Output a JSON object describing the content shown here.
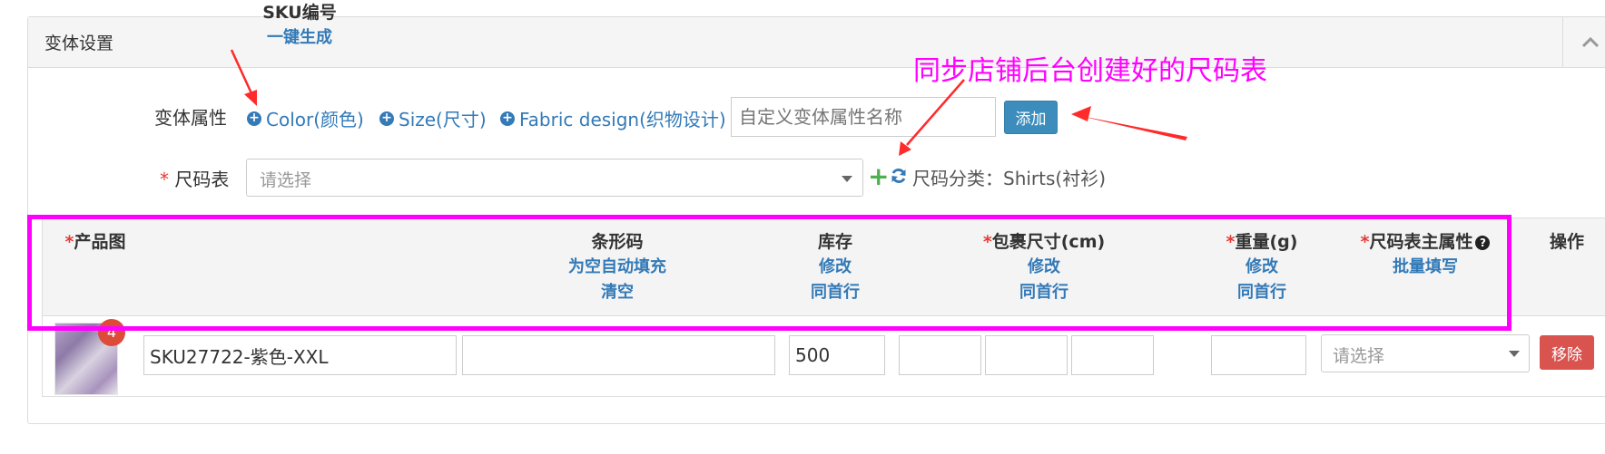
{
  "panel": {
    "title": "变体设置"
  },
  "variant_attrs": {
    "label": "变体属性",
    "options": [
      "Color(颜色)",
      "Size(尺寸)",
      "Fabric design(织物设计)"
    ],
    "custom_placeholder": "自定义变体属性名称",
    "add_label": "添加"
  },
  "size_chart": {
    "required_mark": "*",
    "label": "尺码表",
    "placeholder": "请选择",
    "category_text": "尺码分类：Shirts(衬衫)"
  },
  "annotation": {
    "text": "同步店铺后台创建好的尺码表",
    "color": "#ff00ff"
  },
  "table": {
    "headers": [
      {
        "req": "*",
        "title": "产品图",
        "subs": []
      },
      {
        "req": "",
        "title": "SKU编号",
        "subs": [
          "一键生成"
        ]
      },
      {
        "req": "",
        "title": "条形码",
        "subs": [
          "为空自动填充",
          "清空"
        ]
      },
      {
        "req": "",
        "title": "库存",
        "subs": [
          "修改",
          "同首行"
        ]
      },
      {
        "req": "*",
        "title": "包裹尺寸(cm)",
        "subs": [
          "修改",
          "同首行"
        ]
      },
      {
        "req": "*",
        "title": "重量(g)",
        "subs": [
          "修改",
          "同首行"
        ]
      },
      {
        "req": "*",
        "title": "尺码表主属性",
        "subs": [
          "批量填写"
        ]
      },
      {
        "req": "",
        "title": "操作",
        "subs": []
      }
    ],
    "rows": [
      {
        "image_badge": "4",
        "sku": "SKU27722-紫色-XXL",
        "barcode": "",
        "stock": "500",
        "length": "",
        "width": "",
        "height": "",
        "weight": "",
        "main_attr_placeholder": "请选择",
        "remove_label": "移除"
      }
    ]
  },
  "colors": {
    "link": "#337ab7",
    "primary": "#3c8dbc",
    "danger": "#d9534f",
    "required": "#e53935",
    "arrow": "#ff2a2a",
    "highlight": "#ff00ff"
  }
}
